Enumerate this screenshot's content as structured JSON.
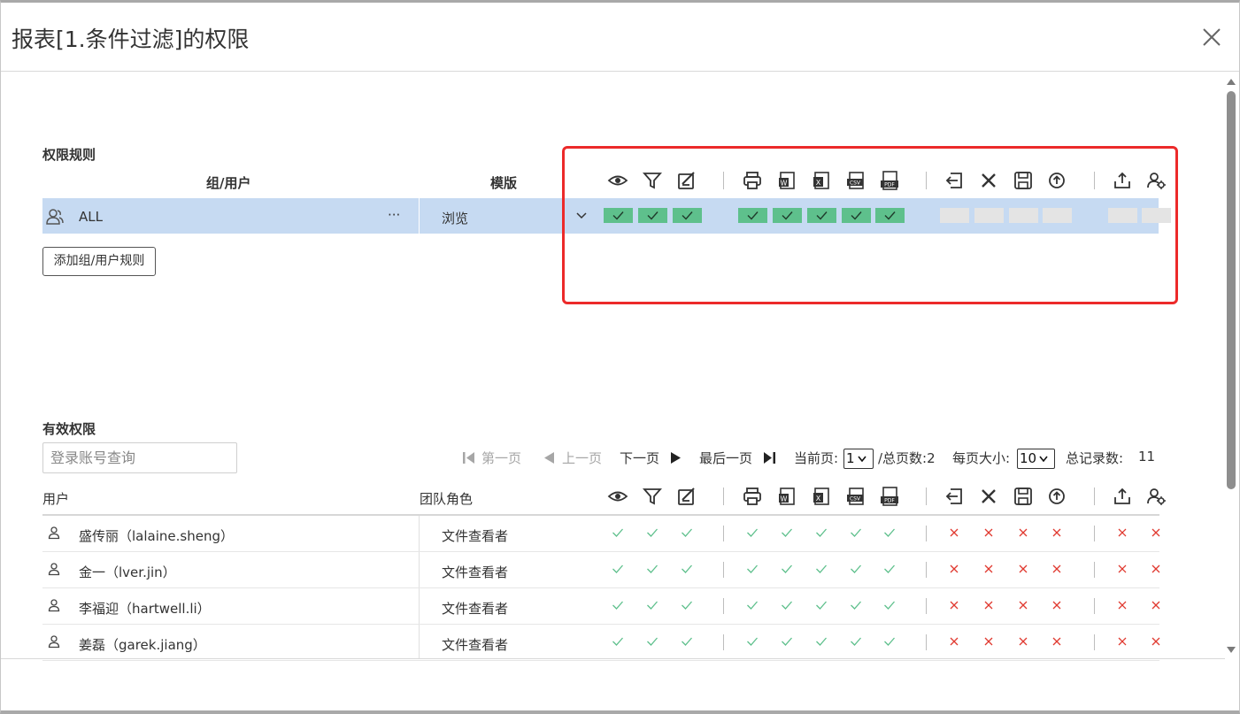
{
  "dialog": {
    "title": "报表[1.条件过滤]的权限",
    "close_icon": "close-icon"
  },
  "rules": {
    "section_title": "权限规则",
    "col_group_user": "组/用户",
    "col_template": "模版",
    "row": {
      "name": "ALL",
      "more": "···",
      "template": "浏览",
      "icon": "group-icon"
    },
    "add_button": "添加组/用户规则",
    "highlight_color": "#ec2a2a"
  },
  "permission_icons": [
    "view-icon",
    "filter-icon",
    "edit-icon",
    "print-icon",
    "export-word-icon",
    "export-excel-icon",
    "export-csv-icon",
    "export-pdf-icon",
    "import-icon",
    "delete-icon",
    "save-icon",
    "upload-circle-icon",
    "share-icon",
    "user-manage-icon"
  ],
  "effective": {
    "section_title": "有效权限",
    "search_placeholder": "登录账号查询",
    "pager": {
      "first": "第一页",
      "prev": "上一页",
      "next": "下一页",
      "last": "最后一页",
      "current_label": "当前页:",
      "current_value": "1",
      "total_pages": "/总页数:2",
      "page_size_label": "每页大小:",
      "page_size_value": "10",
      "total_label": "总记录数:",
      "total_value": "11"
    },
    "col_user": "用户",
    "col_role": "团队角色",
    "rows": [
      {
        "user": "盛传丽（lalaine.sheng）",
        "role": "文件查看者"
      },
      {
        "user": "金一（lver.jin）",
        "role": "文件查看者"
      },
      {
        "user": "李福迎（hartwell.li）",
        "role": "文件查看者"
      },
      {
        "user": "姜磊（garek.jiang）",
        "role": "文件查看者"
      }
    ],
    "allowed_color": "#5ec08c",
    "denied_color": "#e0392f"
  }
}
